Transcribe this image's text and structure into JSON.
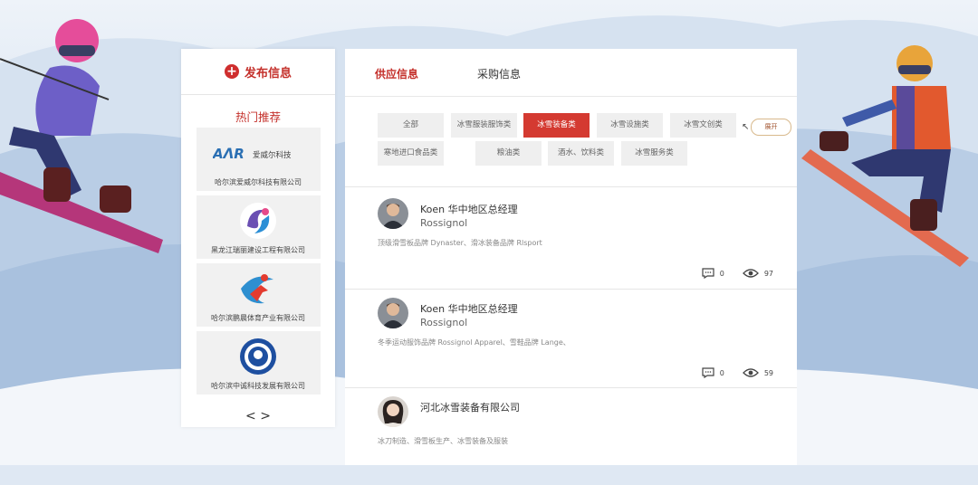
{
  "sidebar": {
    "publish_label": "发布信息",
    "hot_title": "热门推荐",
    "companies": [
      {
        "name": "哈尔滨爱威尔科技有限公司",
        "logo_text": "爱威尔科技",
        "logo_icon": "awl-logo-icon"
      },
      {
        "name": "黑龙江瑞丽建设工程有限公司",
        "logo_icon": "ruili-logo-icon"
      },
      {
        "name": "哈尔滨鹏晨体育产业有限公司",
        "logo_icon": "pengchen-logo-icon"
      },
      {
        "name": "哈尔滨中诚科技发展有限公司",
        "logo_icon": "zhongcheng-logo-icon"
      }
    ],
    "pager": "< >"
  },
  "tabs": [
    {
      "label": "供应信息",
      "active": true
    },
    {
      "label": "采购信息",
      "active": false
    }
  ],
  "categories": [
    {
      "label": "全部",
      "selected": false
    },
    {
      "label": "冰雪服装服饰类",
      "selected": false
    },
    {
      "label": "冰雪装备类",
      "selected": true
    },
    {
      "label": "冰雪设施类",
      "selected": false
    },
    {
      "label": "冰雪文创类",
      "selected": false
    },
    {
      "label": "寒地进口食品类",
      "selected": false
    },
    {
      "label": "粮油类",
      "selected": false
    },
    {
      "label": "酒水、饮料类",
      "selected": false
    },
    {
      "label": "冰雪服务类",
      "selected": false
    }
  ],
  "expand_label": "展开",
  "posts": [
    {
      "name": "Koen 华中地区总经理",
      "brand": "Rossignol",
      "desc": "顶级滑雪板品牌 Dynaster、滑冰装备品牌 Rlsport",
      "comments": "0",
      "views": "97"
    },
    {
      "name": "Koen 华中地区总经理",
      "brand": "Rossignol",
      "desc": "冬季运动服饰品牌 Rossignol Apparel、雪鞋品牌 Lange、",
      "comments": "0",
      "views": "59"
    },
    {
      "name": "河北冰雪装备有限公司",
      "brand": "",
      "desc": "冰刀制造、滑雪板生产、冰雪装备及服装",
      "comments": "",
      "views": ""
    }
  ],
  "colors": {
    "accent": "#c4302b",
    "selected_cat": "#d43a31"
  }
}
